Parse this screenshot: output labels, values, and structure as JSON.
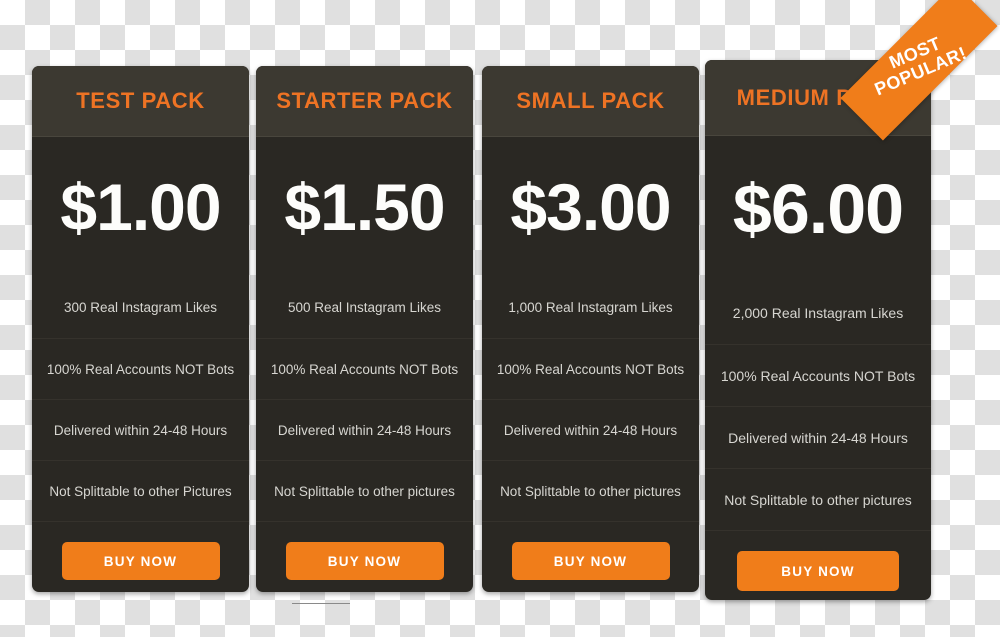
{
  "page": {
    "kind": "pricing-table",
    "accent_color": "#f07d1a",
    "title_color": "#ee7324",
    "card_bg": "#2a2823",
    "card_header_bg": "#3c3931",
    "price_color": "#fdfdfb",
    "feature_color": "#d7d6d1"
  },
  "ribbon": {
    "line1": "MOST",
    "line2": "POPULAR!"
  },
  "plans": [
    {
      "title": "TEST PACK",
      "price": "$1.00",
      "features": [
        "300 Real Instagram Likes",
        "100% Real Accounts NOT Bots",
        "Delivered within 24-48 Hours",
        "Not Splittable to other Pictures"
      ],
      "cta": "BUY NOW"
    },
    {
      "title": "STARTER PACK",
      "price": "$1.50",
      "features": [
        "500 Real Instagram Likes",
        "100% Real Accounts NOT Bots",
        "Delivered within 24-48 Hours",
        "Not Splittable to other pictures"
      ],
      "cta": "BUY NOW"
    },
    {
      "title": "SMALL PACK",
      "price": "$3.00",
      "features": [
        "1,000 Real Instagram Likes",
        "100% Real Accounts NOT Bots",
        "Delivered within 24-48 Hours",
        "Not Splittable to other pictures"
      ],
      "cta": "BUY NOW"
    },
    {
      "title": "MEDIUM PACK",
      "price": "$6.00",
      "features": [
        "2,000 Real Instagram Likes",
        "100% Real Accounts NOT Bots",
        "Delivered within 24-48 Hours",
        "Not Splittable to other pictures"
      ],
      "cta": "BUY NOW"
    }
  ]
}
